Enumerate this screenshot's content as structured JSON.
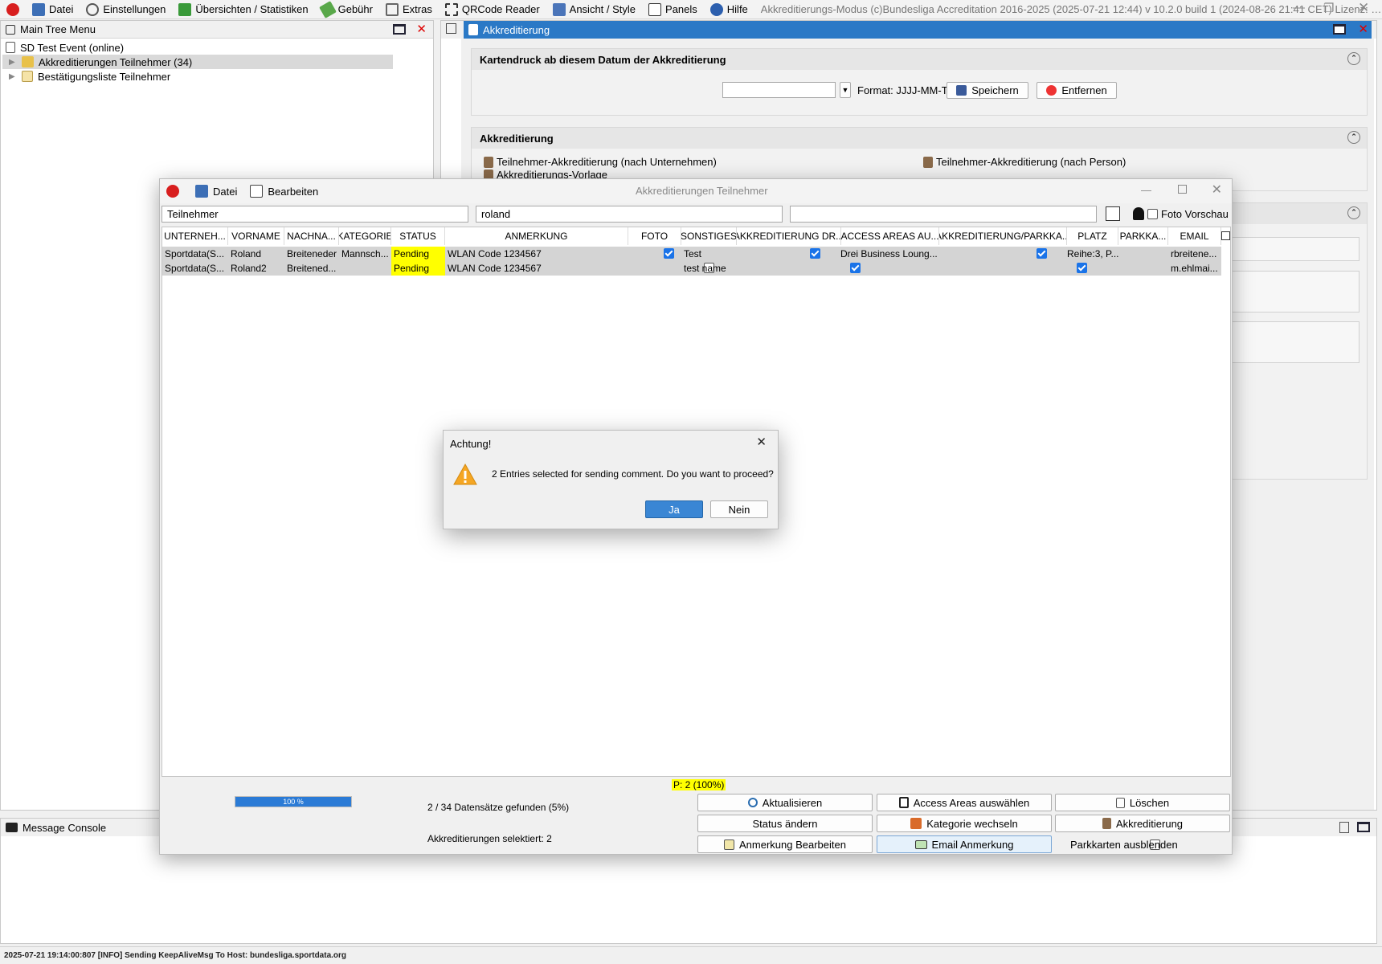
{
  "menubar": {
    "items": [
      "Datei",
      "Einstellungen",
      "Übersichten / Statistiken",
      "Gebühr",
      "Extras",
      "QRCode Reader",
      "Ansicht / Style",
      "Panels",
      "Hilfe"
    ],
    "title": "Akkreditierungs-Modus (c)Bundesliga Accreditation 2016-2025 (2025-07-21 12:44) v 10.2.0 build 1 (2024-08-26 21:41 CET) Lizenz: SDI..."
  },
  "tree": {
    "title": "Main Tree Menu",
    "root": "SD Test Event (online)",
    "items": [
      "Akkreditierungen Teilnehmer (34)",
      "Bestätigungsliste Teilnehmer"
    ]
  },
  "right_panel": {
    "tab": "Akkreditierung",
    "kartendruck": {
      "title": "Kartendruck ab diesem Datum der Akkreditierung",
      "date_value": "",
      "format": "Format: JJJJ-MM-TT",
      "save": "Speichern",
      "remove": "Entfernen"
    },
    "akkreditierung": {
      "title": "Akkreditierung",
      "links": [
        "Teilnehmer-Akkreditierung (nach Unternehmen)",
        "Teilnehmer-Akkreditierung (nach Person)",
        "Akkreditierungs-Vorlage"
      ]
    }
  },
  "dialog": {
    "menu": [
      "Datei",
      "Bearbeiten"
    ],
    "title": "Akkreditierungen Teilnehmer",
    "filters": [
      "Teilnehmer",
      "roland",
      ""
    ],
    "foto_vorschau": "Foto Vorschau",
    "columns": [
      "UNTERNEH...",
      "VORNAME",
      "NACHNA...",
      "KATEGORIE",
      "STATUS",
      "ANMERKUNG",
      "FOTO",
      "SONSTIGES",
      "AKKREDITIERUNG DR...",
      "ACCESS AREAS AU...",
      "AKKREDITIERUNG/PARKKA...",
      "PLATZ",
      "PARKKA...",
      "EMAIL"
    ],
    "rows": [
      {
        "unternehmen": "Sportdata(S...",
        "vorname": "Roland",
        "nachname": "Breiteneder",
        "kategorie": "Mannsch...",
        "status": "Pending",
        "anmerkung": "WLAN Code 1234567",
        "foto": true,
        "sonstiges": "Test",
        "akk_dr": true,
        "access": "Drei Business Loung...",
        "akk_park": true,
        "platz": "Reihe:3, P...",
        "parkka": "",
        "email": "rbreitene..."
      },
      {
        "unternehmen": "Sportdata(S...",
        "vorname": "Roland2",
        "nachname": "Breitened...",
        "kategorie": "",
        "status": "Pending",
        "anmerkung": "WLAN Code 1234567",
        "foto": false,
        "sonstiges": "test name",
        "akk_dr": true,
        "access": "",
        "akk_park": true,
        "platz": "",
        "parkka": "",
        "email": "m.ehlmai..."
      }
    ],
    "progress_label": "100 %",
    "progress_fraction": 1.0,
    "found": "2 / 34 Datensätze gefunden (5%)",
    "selected": "Akkreditierungen selektiert: 2",
    "p_badge": "P: 2 (100%)",
    "buttons": {
      "aktualisieren": "Aktualisieren",
      "access": "Access Areas auswählen",
      "loeschen": "Löschen",
      "status": "Status ändern",
      "kategorie": "Kategorie wechseln",
      "akkreditierung": "Akkreditierung",
      "anmerkung": "Anmerkung Bearbeiten",
      "email": "Email Anmerkung",
      "parkkarten": "Parkkarten ausblenden"
    }
  },
  "alert": {
    "title": "Achtung!",
    "message": "2 Entries selected for sending comment. Do you want to proceed?",
    "yes": "Ja",
    "no": "Nein"
  },
  "console": {
    "title": "Message Console",
    "status": "2025-07-21 19:14:00:807 [INFO] Sending KeepAliveMsg To Host: bundesliga.sportdata.org"
  },
  "colors": {
    "accent": "#2b79c6",
    "pending": "#ffff00",
    "checkbox": "#1a73e8",
    "progress": "#2b7bd6"
  }
}
